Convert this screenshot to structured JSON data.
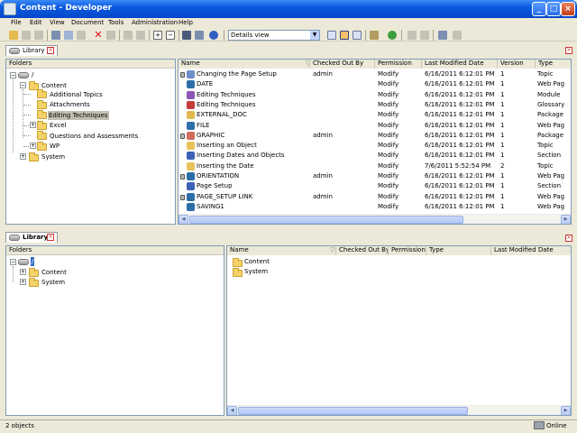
{
  "window": {
    "title": "Content - Developer"
  },
  "menu": [
    "File",
    "Edit",
    "View",
    "Document",
    "Tools",
    "Administration",
    "Help"
  ],
  "toolbar": {
    "view_select": "Details view"
  },
  "top_panel": {
    "tab_label": "Library",
    "folders_header": "Folders",
    "tree": {
      "root": "/",
      "content": "Content",
      "children": [
        "Additional Topics",
        "Attachments",
        "Editing Techniques",
        "Excel",
        "Questions and Assessments",
        "WP"
      ],
      "system": "System"
    },
    "columns": [
      "Name",
      "Checked Out By",
      "Permission",
      "Last Modified Date",
      "Version",
      "Type"
    ],
    "rows": [
      {
        "name": "Changing the Page Setup",
        "checked_out_by": "admin",
        "permission": "Modify",
        "modified": "6/16/2011 6:12:01 PM",
        "version": "1",
        "type": "Topic",
        "icon_color": "#6f8fc9",
        "locked": true
      },
      {
        "name": "DATE",
        "checked_out_by": "",
        "permission": "Modify",
        "modified": "6/16/2011 6:12:01 PM",
        "version": "1",
        "type": "Web Pag",
        "icon_color": "#2c6fa8",
        "locked": false
      },
      {
        "name": "Editing Techniques",
        "checked_out_by": "",
        "permission": "Modify",
        "modified": "6/16/2011 6:12:01 PM",
        "version": "1",
        "type": "Module",
        "icon_color": "#8a56b6",
        "locked": false
      },
      {
        "name": "Editing Techniques",
        "checked_out_by": "",
        "permission": "Modify",
        "modified": "6/16/2011 6:12:01 PM",
        "version": "1",
        "type": "Glossary",
        "icon_color": "#c33c3c",
        "locked": false
      },
      {
        "name": "EXTERNAL_DOC",
        "checked_out_by": "",
        "permission": "Modify",
        "modified": "6/16/2011 6:12:01 PM",
        "version": "1",
        "type": "Package",
        "icon_color": "#e0b94a",
        "locked": false
      },
      {
        "name": "FILE",
        "checked_out_by": "",
        "permission": "Modify",
        "modified": "6/16/2011 6:12:01 PM",
        "version": "1",
        "type": "Web Pag",
        "icon_color": "#2c6fa8",
        "locked": false
      },
      {
        "name": "GRAPHIC",
        "checked_out_by": "admin",
        "permission": "Modify",
        "modified": "6/16/2011 6:12:01 PM",
        "version": "1",
        "type": "Package",
        "icon_color": "#d16b5a",
        "locked": true
      },
      {
        "name": "Inserting an Object",
        "checked_out_by": "",
        "permission": "Modify",
        "modified": "6/16/2011 6:12:01 PM",
        "version": "1",
        "type": "Topic",
        "icon_color": "#e8c35a",
        "locked": false
      },
      {
        "name": "Inserting Dates and Objects",
        "checked_out_by": "",
        "permission": "Modify",
        "modified": "6/16/2011 6:12:01 PM",
        "version": "1",
        "type": "Section",
        "icon_color": "#3b62b5",
        "locked": false
      },
      {
        "name": "Inserting the Date",
        "checked_out_by": "",
        "permission": "Modify",
        "modified": "7/6/2011 5:52:54 PM",
        "version": "2",
        "type": "Topic",
        "icon_color": "#e8c35a",
        "locked": false
      },
      {
        "name": "ORIENTATION",
        "checked_out_by": "admin",
        "permission": "Modify",
        "modified": "6/16/2011 6:12:01 PM",
        "version": "1",
        "type": "Web Pag",
        "icon_color": "#2c6fa8",
        "locked": true
      },
      {
        "name": "Page Setup",
        "checked_out_by": "",
        "permission": "Modify",
        "modified": "6/16/2011 6:12:01 PM",
        "version": "1",
        "type": "Section",
        "icon_color": "#3b62b5",
        "locked": false
      },
      {
        "name": "PAGE_SETUP LINK",
        "checked_out_by": "admin",
        "permission": "Modify",
        "modified": "6/16/2011 6:12:01 PM",
        "version": "1",
        "type": "Web Pag",
        "icon_color": "#2c6fa8",
        "locked": true
      },
      {
        "name": "SAVING1",
        "checked_out_by": "",
        "permission": "Modify",
        "modified": "6/16/2011 6:12:01 PM",
        "version": "1",
        "type": "Web Pag",
        "icon_color": "#2c6fa8",
        "locked": false
      }
    ]
  },
  "bottom_panel": {
    "tab_label": "Library",
    "folders_header": "Folders",
    "tree": {
      "root": "/",
      "children": [
        "Content",
        "System"
      ]
    },
    "columns": [
      "Name",
      "Checked Out By",
      "Permission",
      "Type",
      "Last Modified Date"
    ],
    "rows": [
      {
        "name": "Content"
      },
      {
        "name": "System"
      }
    ]
  },
  "status": {
    "left": "2 objects",
    "right": "Online"
  }
}
